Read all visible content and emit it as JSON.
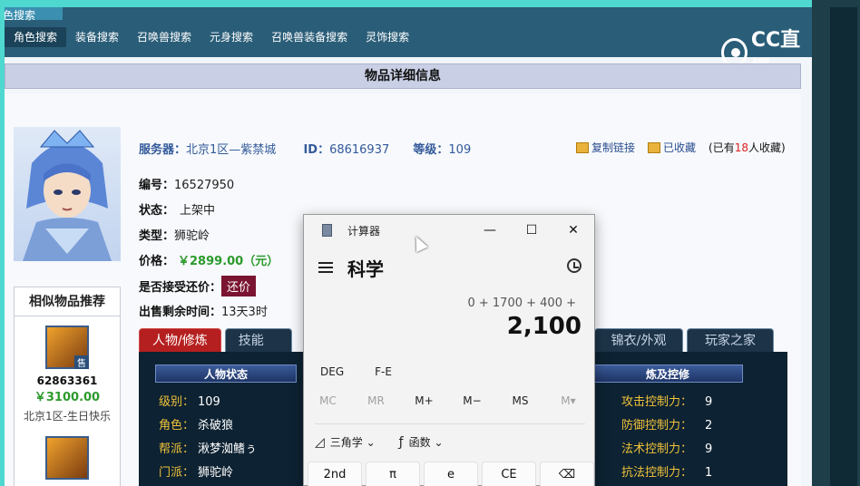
{
  "site": {
    "brand": "色搜索",
    "nav": [
      "角色搜索",
      "装备搜索",
      "召唤兽搜索",
      "元身搜索",
      "召唤兽装备搜索",
      "灵饰搜索"
    ],
    "watermark": "CC直播"
  },
  "detail": {
    "header": "物品详细信息",
    "server_label": "服务器：",
    "server_value": "北京1区—紫禁城",
    "id_label": "ID：",
    "id_value": "68616937",
    "level_label": "等级：",
    "level_value": "109",
    "copy_link": "复制链接",
    "favorited": "已收藏",
    "fav_prefix": "(已有",
    "fav_count": "18",
    "fav_suffix": "人收藏)",
    "number_label": "编号：",
    "number_value": "16527950",
    "status_label": "状态：",
    "status_value": "上架中",
    "type_label": "类型：",
    "type_value": "狮驼岭",
    "price_label": "价格：",
    "price_value": "￥2899.00（元）",
    "bargain_label": "是否接受还价：",
    "bargain_button": "还价",
    "remaining_label": "出售剩余时间：",
    "remaining_value": "13天3时"
  },
  "recommend": {
    "title": "相似物品推荐",
    "items": [
      {
        "id": "62863361",
        "price": "￥3100.00",
        "server": "北京1区-生日快乐",
        "badge": "售"
      }
    ]
  },
  "tabs": {
    "left": [
      "人物/修炼",
      "技能"
    ],
    "right": [
      "锦衣/外观",
      "玩家之家"
    ]
  },
  "panel": {
    "section_left": "人物状态",
    "section_right": "炼及控修",
    "left_rows": [
      {
        "label": "级别：",
        "value": "109"
      },
      {
        "label": "角色：",
        "value": "杀破狼"
      },
      {
        "label": "帮派：",
        "value": "湫梦洳鳍ぅ"
      },
      {
        "label": "门派：",
        "value": "狮驼岭"
      }
    ],
    "right_rows": [
      {
        "label": "攻击控制力：",
        "value": "9"
      },
      {
        "label": "防御控制力：",
        "value": "2"
      },
      {
        "label": "法术控制力：",
        "value": "9"
      },
      {
        "label": "抗法控制力：",
        "value": "1"
      }
    ]
  },
  "calculator": {
    "title": "计算器",
    "mode": "科学",
    "expression": "0 + 1700 + 400 +",
    "result": "2,100",
    "deg": "DEG",
    "fe": "F-E",
    "memory": [
      "MC",
      "MR",
      "M+",
      "M−",
      "MS",
      "M▾"
    ],
    "trig": "三角学",
    "func": "函数",
    "keys": [
      "2nd",
      "π",
      "e",
      "CE",
      "⌫"
    ]
  }
}
